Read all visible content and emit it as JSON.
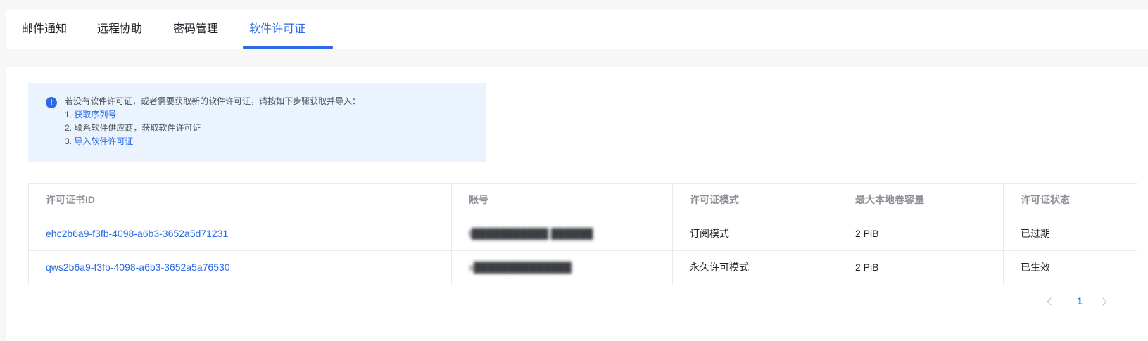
{
  "tabs": [
    {
      "label": "邮件通知"
    },
    {
      "label": "远程协助"
    },
    {
      "label": "密码管理"
    },
    {
      "label": "软件许可证",
      "active": true
    }
  ],
  "notice": {
    "intro": "若没有软件许可证，或者需要获取新的软件许可证，请按如下步骤获取并导入：",
    "steps": [
      {
        "num": "1.",
        "text": "获取序列号",
        "link": true
      },
      {
        "num": "2.",
        "text": "联系软件供应商，获取软件许可证",
        "link": false
      },
      {
        "num": "3.",
        "text": "导入软件许可证",
        "link": true
      }
    ]
  },
  "table": {
    "columns": [
      "许可证书ID",
      "账号",
      "许可证模式",
      "最大本地卷容量",
      "许可证状态"
    ],
    "rows": [
      {
        "id": "ehc2b6a9-f3fb-4098-a6b3-3652a5d71231",
        "account": "t███████████ ██████",
        "mode": "订阅模式",
        "capacity": "2 PiB",
        "status": "已过期"
      },
      {
        "id": "qws2b6a9-f3fb-4098-a6b3-3652a5a76530",
        "account": "x██████████████",
        "mode": "永久许可模式",
        "capacity": "2 PiB",
        "status": "已生效"
      }
    ]
  },
  "pagination": {
    "current_page": "1",
    "prev_icon": "chevron-left-icon",
    "next_icon": "chevron-right-icon"
  },
  "colors": {
    "accent": "#2b6be6",
    "notice_bg": "#ebf4fe"
  }
}
